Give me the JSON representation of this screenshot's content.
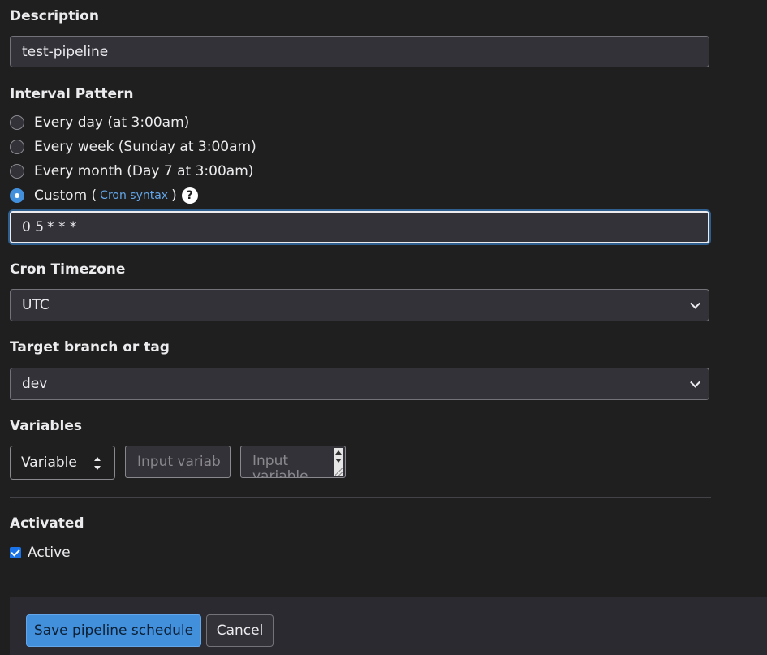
{
  "description": {
    "label": "Description",
    "value": "test-pipeline"
  },
  "interval": {
    "label": "Interval Pattern",
    "options": [
      {
        "label": "Every day (at 3:00am)",
        "checked": false
      },
      {
        "label": "Every week (Sunday at 3:00am)",
        "checked": false
      },
      {
        "label": "Every month (Day 7 at 3:00am)",
        "checked": false
      },
      {
        "label": "Custom (",
        "checked": true
      }
    ],
    "custom_link": "Cron syntax",
    "custom_suffix": ")",
    "help_icon": "?",
    "cron_value_before_caret": "0 5",
    "cron_value_after_caret": "* * *"
  },
  "timezone": {
    "label": "Cron Timezone",
    "value": "UTC"
  },
  "target": {
    "label": "Target branch or tag",
    "value": "dev"
  },
  "variables": {
    "label": "Variables",
    "type_value": "Variable",
    "key_placeholder": "Input variab",
    "value_placeholder": "Input variable"
  },
  "activated": {
    "label": "Activated",
    "checkbox_label": "Active",
    "checked": true
  },
  "footer": {
    "save_label": "Save pipeline schedule",
    "cancel_label": "Cancel"
  },
  "colors": {
    "background": "#1f1f1f",
    "accent": "#428fdc",
    "link": "#63a6e9"
  },
  "icons": {
    "dropdown": "chevron-down-icon",
    "help": "question-circle-icon",
    "select": "sort-arrows-icon"
  }
}
